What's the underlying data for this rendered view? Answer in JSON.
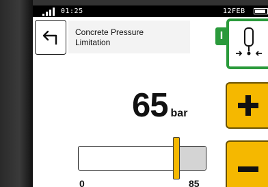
{
  "status": {
    "time": "01:25",
    "date": "12FEB"
  },
  "header": {
    "title_line1": "Concrete Pressure",
    "title_line2": "Limitation",
    "badge": "I"
  },
  "pressure": {
    "value": "65",
    "unit": "bar",
    "min_label": "0",
    "max_label": "85",
    "min": 0,
    "max": 85,
    "current": 65
  },
  "colors": {
    "accent_yellow": "#f5b800",
    "status_green": "#2a9a3b"
  },
  "icons": {
    "back": "back-arrow-icon",
    "mode": "piston-pressure-icon",
    "increase": "plus-icon",
    "decrease": "minus-icon"
  }
}
